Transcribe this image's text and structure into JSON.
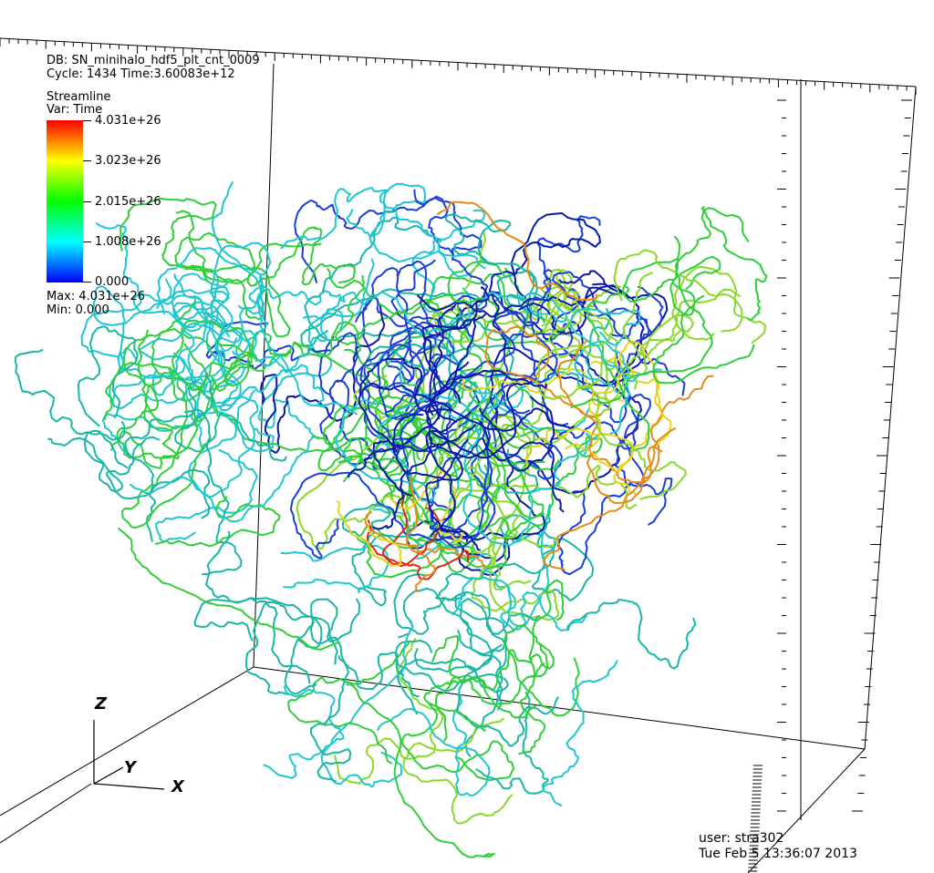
{
  "legend": {
    "db_line": "DB: SN_minihalo_hdf5_plt_cnt_0009",
    "cycle_line": "Cycle: 1434     Time:3.60083e+12",
    "plot_name": "Streamline",
    "var_line": "Var: Time",
    "tick_labels": [
      "4.031e+26",
      "3.023e+26",
      "2.015e+26",
      "1.008e+26",
      "0.000"
    ],
    "max_line": "Max:  4.031e+26",
    "min_line": "Min:  0.000",
    "colormap": [
      "#0000ff",
      "#00ffff",
      "#00ff00",
      "#ffff00",
      "#ff0000"
    ]
  },
  "triad": {
    "z": "Z",
    "y": "Y",
    "x": "X"
  },
  "footer": {
    "user_line": "user: stra302",
    "date_line": "Tue Feb  5 13:36:07 2013"
  },
  "streamline_colors": {
    "blue": "#1a3fd6",
    "deep_blue": "#0a1aa8",
    "cyan": "#1fc7d0",
    "teal": "#19b7a6",
    "green": "#2fcf3a",
    "lime": "#8ad92a",
    "yellow": "#e8d318",
    "orange": "#e88a18",
    "red": "#d92a18"
  }
}
